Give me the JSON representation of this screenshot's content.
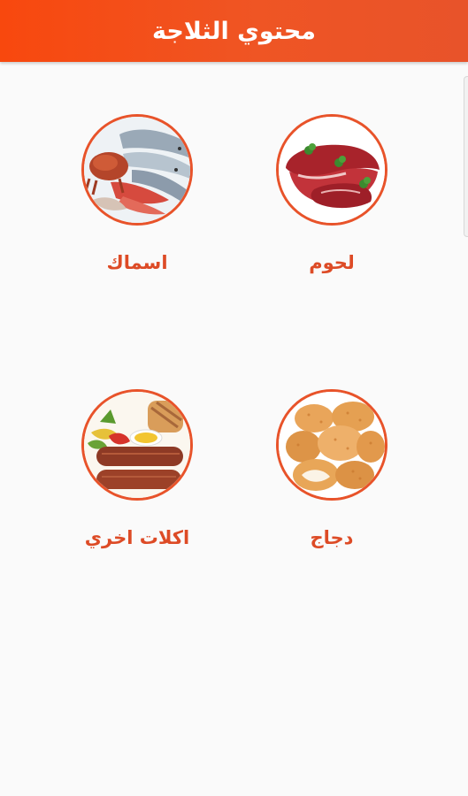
{
  "header": {
    "title": "محتوي الثلاجة"
  },
  "categories": [
    {
      "label": "لحوم",
      "image": "raw-meat-image"
    },
    {
      "label": "اسماك",
      "image": "seafood-image"
    },
    {
      "label": "دجاج",
      "image": "chicken-nuggets-image"
    },
    {
      "label": "اكلات اخري",
      "image": "sausages-vegetables-image"
    }
  ],
  "colors": {
    "header_start": "#f8480e",
    "header_end": "#e8532a",
    "accent": "#e8532a",
    "label": "#dd4b26",
    "background": "#fafafa"
  }
}
